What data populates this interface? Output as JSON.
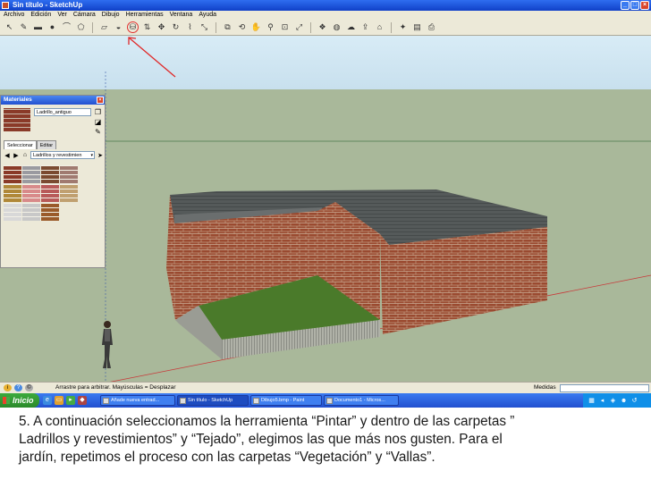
{
  "window": {
    "title": "Sin título - SketchUp",
    "buttons": [
      "_",
      "□",
      "×"
    ]
  },
  "menubar": [
    "Archivo",
    "Edición",
    "Ver",
    "Cámara",
    "Dibujo",
    "Herramientas",
    "Ventana",
    "Ayuda"
  ],
  "toolbar": {
    "tools": [
      {
        "icon": "select-arrow-icon",
        "glyph": "↖"
      },
      {
        "icon": "pencil-icon",
        "glyph": "✎"
      },
      {
        "icon": "rectangle-icon",
        "glyph": "▬"
      },
      {
        "icon": "circle-icon",
        "glyph": "●"
      },
      {
        "icon": "arc-icon",
        "glyph": "⌒"
      },
      {
        "icon": "polygon-icon",
        "glyph": "⬠"
      },
      {
        "icon": "eraser-icon",
        "glyph": "▱"
      },
      {
        "icon": "tape-measure-icon",
        "glyph": "◒"
      },
      {
        "icon": "paint-bucket-icon",
        "glyph": "⛁"
      },
      {
        "icon": "push-pull-icon",
        "glyph": "⇅"
      },
      {
        "icon": "move-icon",
        "glyph": "✥"
      },
      {
        "icon": "rotate-icon",
        "glyph": "↻"
      },
      {
        "icon": "follow-me-icon",
        "glyph": "⌇"
      },
      {
        "icon": "scale-icon",
        "glyph": "⤡"
      },
      {
        "icon": "offset-icon",
        "glyph": "⧉"
      },
      {
        "icon": "orbit-icon",
        "glyph": "⟲"
      },
      {
        "icon": "pan-icon",
        "glyph": "✋"
      },
      {
        "icon": "zoom-icon",
        "glyph": "⚲"
      },
      {
        "icon": "zoom-window-icon",
        "glyph": "⊡"
      },
      {
        "icon": "zoom-extents-icon",
        "glyph": "⤢"
      },
      {
        "icon": "components-icon",
        "glyph": "❖"
      },
      {
        "icon": "materials-icon",
        "glyph": "◍"
      },
      {
        "icon": "get-models-icon",
        "glyph": "☁"
      },
      {
        "icon": "share-model-icon",
        "glyph": "⇪"
      },
      {
        "icon": "warehouse-icon",
        "glyph": "⌂"
      },
      {
        "icon": "extension-icon",
        "glyph": "✦"
      },
      {
        "icon": "layout-icon",
        "glyph": "▤"
      },
      {
        "icon": "print-icon",
        "glyph": "⎙"
      }
    ]
  },
  "materials_panel": {
    "title": "Materiales",
    "close": "×",
    "material_name": "Ladrillo_antiguo",
    "tabs": [
      "Seleccionar",
      "Editar"
    ],
    "library": "Ladrillos y revestimien",
    "dropdown_arrow": "▾",
    "swatch_colors": [
      "#8a3a28",
      "#9a9aa0",
      "#7a4a30",
      "#a07a70",
      "#b08838",
      "#d88a8a",
      "#b85a58",
      "#c0a070",
      "#d8d8d8",
      "#c8c8c8",
      "#9a5a2a"
    ]
  },
  "statusbar": {
    "hint": "Arrastre para arbitrar.  Mayúsculas = Desplazar",
    "measures_label": "Medidas"
  },
  "taskbar": {
    "start": "Inicio",
    "tasks": [
      {
        "label": "Añade nueva entrad...",
        "active": false
      },
      {
        "label": "Sin título - SketchUp",
        "active": true
      },
      {
        "label": "Dibujo5.bmp - Paint",
        "active": false
      },
      {
        "label": "Documento1 - Micros...",
        "active": false
      }
    ]
  },
  "instruction": {
    "line1": "5. A continuación seleccionamos la herramienta “Pintar” y dentro de las carpetas ”",
    "line2": "Ladrillos y revestimientos” y “Tejado”, elegimos las que más nos gusten. Para el",
    "line3": "jardín, repetimos el proceso con las carpetas “Vegetación” y “Vallas”."
  }
}
